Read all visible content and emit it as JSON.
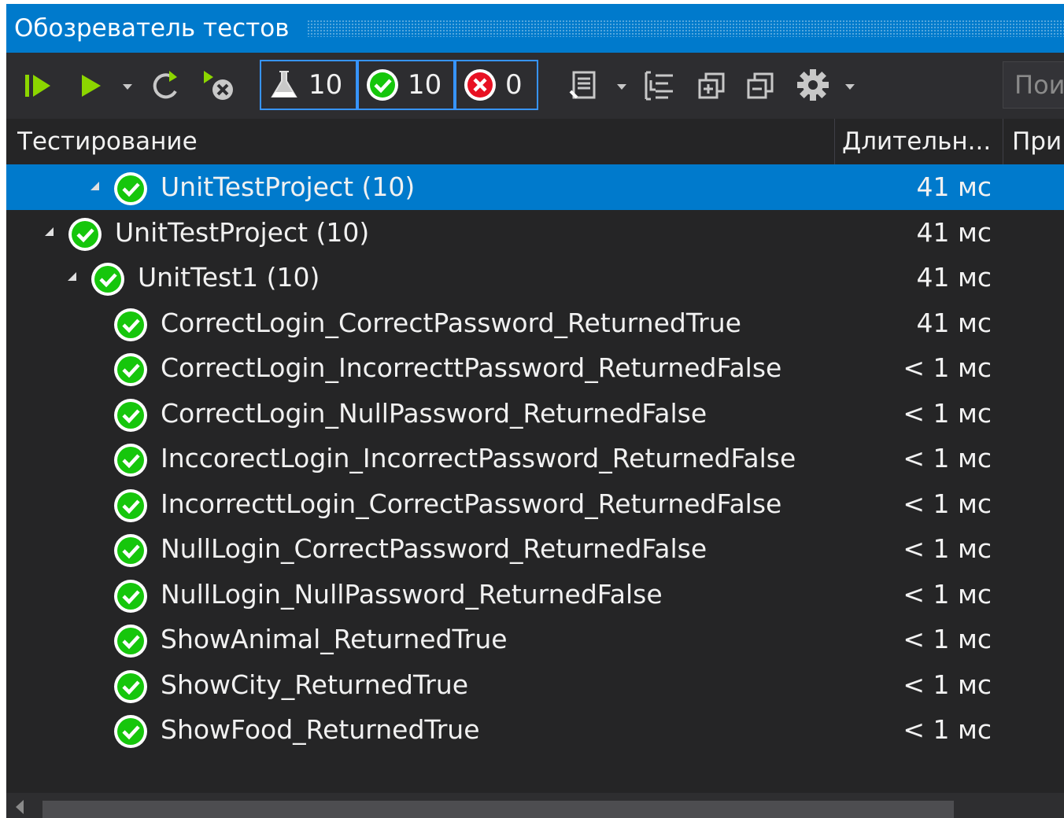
{
  "window": {
    "title": "Обозреватель тестов"
  },
  "toolbar": {
    "total_count": "10",
    "passed_count": "10",
    "failed_count": "0",
    "search_placeholder": "Пои",
    "icons": [
      "run-all-icon",
      "run-icon",
      "dropdown-icon",
      "refresh-icon",
      "cancel-icon",
      "flask-icon",
      "passed-icon",
      "failed-icon",
      "playlist-icon",
      "group-by-icon",
      "expand-icon",
      "collapse-icon",
      "settings-icon"
    ]
  },
  "columns": {
    "test": "Тестирование",
    "duration": "Длительн...",
    "traits": "При"
  },
  "colors": {
    "accent": "#007acc",
    "pass": "#16c60c",
    "fail": "#e81123",
    "background": "#252526"
  },
  "tree": [
    {
      "label": "UnitTestProject  (10)",
      "duration": "41 мс",
      "status": "passed",
      "selected": true
    },
    {
      "label": "UnitTestProject  (10)",
      "duration": "41 мс",
      "status": "passed"
    },
    {
      "label": "UnitTest1  (10)",
      "duration": "41 мс",
      "status": "passed"
    },
    {
      "label": "CorrectLogin_CorrectPassword_ReturnedTrue",
      "duration": "41 мс",
      "status": "passed"
    },
    {
      "label": "CorrectLogin_IncorrecttPassword_ReturnedFalse",
      "duration": "< 1 мс",
      "status": "passed"
    },
    {
      "label": "CorrectLogin_NullPassword_ReturnedFalse",
      "duration": "< 1 мс",
      "status": "passed"
    },
    {
      "label": "InccorectLogin_IncorrectPassword_ReturnedFalse",
      "duration": "< 1 мс",
      "status": "passed"
    },
    {
      "label": "IncorrecttLogin_CorrectPassword_ReturnedFalse",
      "duration": "< 1 мс",
      "status": "passed"
    },
    {
      "label": "NullLogin_CorrectPassword_ReturnedFalse",
      "duration": "< 1 мс",
      "status": "passed"
    },
    {
      "label": "NullLogin_NullPassword_ReturnedFalse",
      "duration": "< 1 мс",
      "status": "passed"
    },
    {
      "label": "ShowAnimal_ReturnedTrue",
      "duration": "< 1 мс",
      "status": "passed"
    },
    {
      "label": "ShowCity_ReturnedTrue",
      "duration": "< 1 мс",
      "status": "passed"
    },
    {
      "label": "ShowFood_ReturnedTrue",
      "duration": "< 1 мс",
      "status": "passed"
    }
  ]
}
